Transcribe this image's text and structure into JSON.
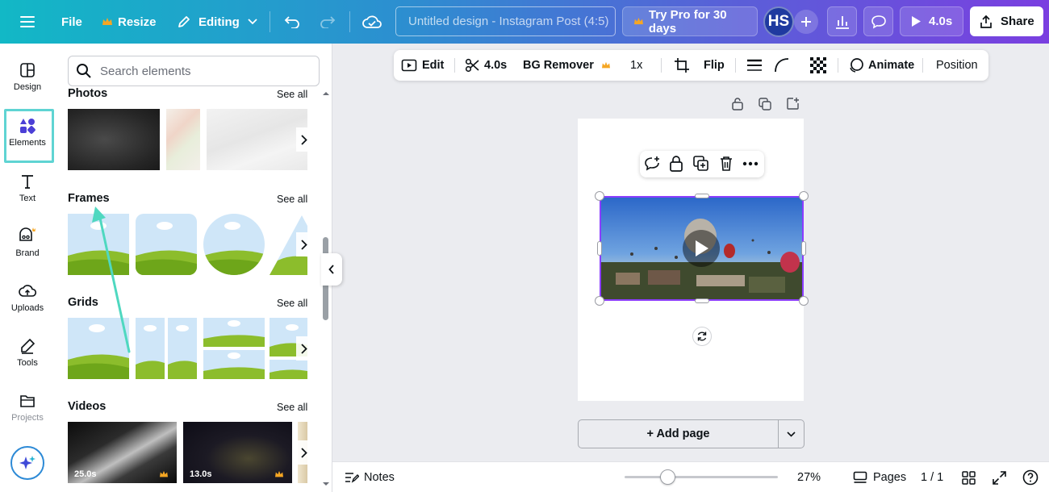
{
  "topbar": {
    "file_label": "File",
    "resize_label": "Resize",
    "editing_label": "Editing",
    "document_title": "Untitled design - Instagram Post (4:5)",
    "try_pro_label": "Try Pro for 30 days",
    "avatar_initials": "HS",
    "play_duration": "4.0s",
    "share_label": "Share"
  },
  "rail": {
    "items": [
      {
        "label": "Design"
      },
      {
        "label": "Elements"
      },
      {
        "label": "Text"
      },
      {
        "label": "Brand"
      },
      {
        "label": "Uploads"
      },
      {
        "label": "Tools"
      },
      {
        "label": "Projects"
      }
    ],
    "active": "Elements"
  },
  "panel": {
    "search_placeholder": "Search elements",
    "sections": [
      {
        "title": "Photos",
        "see_all": "See all"
      },
      {
        "title": "Frames",
        "see_all": "See all"
      },
      {
        "title": "Grids",
        "see_all": "See all"
      },
      {
        "title": "Videos",
        "see_all": "See all"
      }
    ],
    "videos": [
      {
        "duration": "25.0s"
      },
      {
        "duration": "13.0s"
      }
    ]
  },
  "context_toolbar": {
    "edit": "Edit",
    "duration": "4.0s",
    "bg_remover": "BG Remover",
    "speed": "1x",
    "flip": "Flip",
    "animate": "Animate",
    "position": "Position"
  },
  "canvas": {
    "add_page": "+ Add page"
  },
  "bottombar": {
    "notes": "Notes",
    "zoom": "27%",
    "pages": "Pages",
    "page_count": "1 / 1"
  },
  "colors": {
    "accent_selection": "#8b3dff",
    "rail_active_border": "#5fd4d3",
    "annotation_arrow": "#4fd8c0",
    "pro_crown": "#f5a623"
  }
}
